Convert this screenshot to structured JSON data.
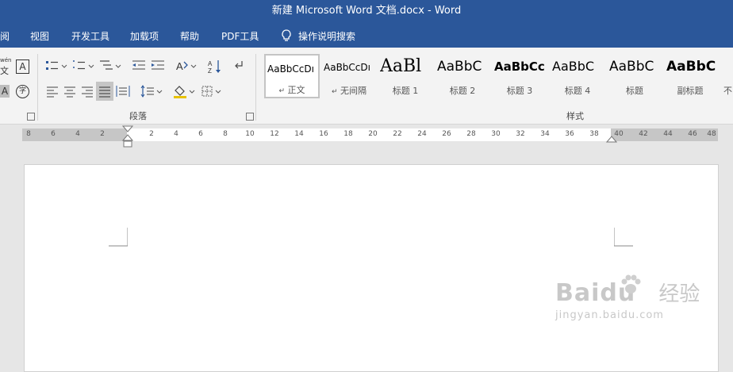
{
  "window": {
    "title": "新建 Microsoft Word 文档.docx  -  Word"
  },
  "tabs": [
    "阅",
    "视图",
    "开发工具",
    "加载项",
    "帮助",
    "PDF工具"
  ],
  "tell_me": {
    "label": "操作说明搜索"
  },
  "font_group": {
    "phonetic_label": "wén",
    "phonetic_char": "文",
    "border_char": "A",
    "shade_char": "A",
    "enclose_char": "字"
  },
  "paragraph_group": {
    "label": "段落"
  },
  "styles_group": {
    "label": "样式",
    "items": [
      {
        "preview": "AaBbCcDı",
        "name": "正文",
        "marker": "↵"
      },
      {
        "preview": "AaBbCcDı",
        "name": "无间隔",
        "marker": "↵"
      },
      {
        "preview": "AaBl",
        "name": "标题 1"
      },
      {
        "preview": "AaBbC",
        "name": "标题 2"
      },
      {
        "preview": "AaBbCc",
        "name": "标题 3"
      },
      {
        "preview": "AaBbC",
        "name": "标题 4"
      },
      {
        "preview": "AaBbC",
        "name": "标题"
      },
      {
        "preview": "AaBbC",
        "name": "副标题"
      },
      {
        "preview": "",
        "name": "不"
      }
    ]
  },
  "ruler": {
    "left_numbers": [
      "8",
      "6",
      "4",
      "2"
    ],
    "right_numbers": [
      "2",
      "4",
      "6",
      "8",
      "10",
      "12",
      "14",
      "16",
      "18",
      "20",
      "22",
      "24",
      "26",
      "28",
      "30",
      "32",
      "34",
      "36",
      "38",
      "40",
      "42",
      "44",
      "46",
      "48"
    ]
  },
  "watermark": {
    "brand": "Baidu",
    "word": "经验",
    "url": "jingyan.baidu.com"
  },
  "colors": {
    "brand": "#2b579a",
    "ribbon": "#f3f3f3",
    "canvas": "#e6e6e6"
  }
}
